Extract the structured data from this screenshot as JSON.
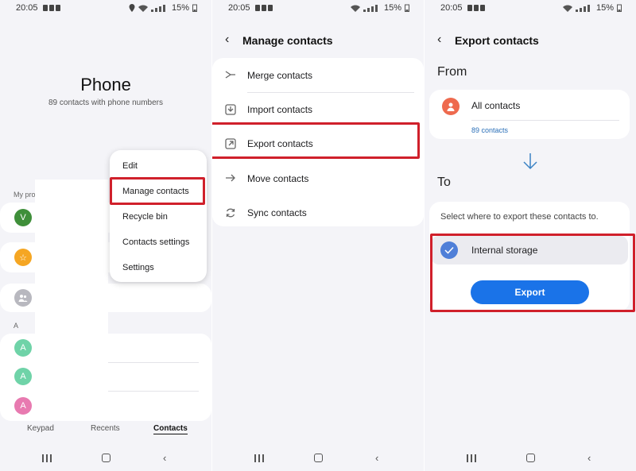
{
  "status": {
    "time": "20:05",
    "battery": "15%"
  },
  "screen1": {
    "title": "Phone",
    "subtitle": "89 contacts with phone numbers",
    "my_profile_label": "My profile",
    "avatars": [
      {
        "letter": "V",
        "color": "#3f8f3a"
      },
      {
        "letter": "☆",
        "color": "#f5a623"
      },
      {
        "letter": "",
        "color": "#b8b8bf"
      }
    ],
    "section_a_label": "A",
    "a_contacts": [
      {
        "letter": "A",
        "color": "#6fd3a8"
      },
      {
        "letter": "A",
        "color": "#6fd3a8"
      },
      {
        "letter": "A",
        "color": "#e87ab0"
      }
    ],
    "menu": [
      "Edit",
      "Manage contacts",
      "Recycle bin",
      "Contacts settings",
      "Settings"
    ],
    "tabs": [
      "Keypad",
      "Recents",
      "Contacts"
    ]
  },
  "screen2": {
    "title": "Manage contacts",
    "items": [
      "Merge contacts",
      "Import contacts",
      "Export contacts",
      "Move contacts",
      "Sync contacts"
    ]
  },
  "screen3": {
    "title": "Export contacts",
    "from_label": "From",
    "source_name": "All contacts",
    "source_count": "89 contacts",
    "to_label": "To",
    "select_prompt": "Select where to export these contacts to.",
    "destination": "Internal storage",
    "export_label": "Export"
  },
  "colors": {
    "highlight": "#d0202b",
    "accent": "#1a73e8",
    "panel_bg": "#f4f4f8"
  }
}
